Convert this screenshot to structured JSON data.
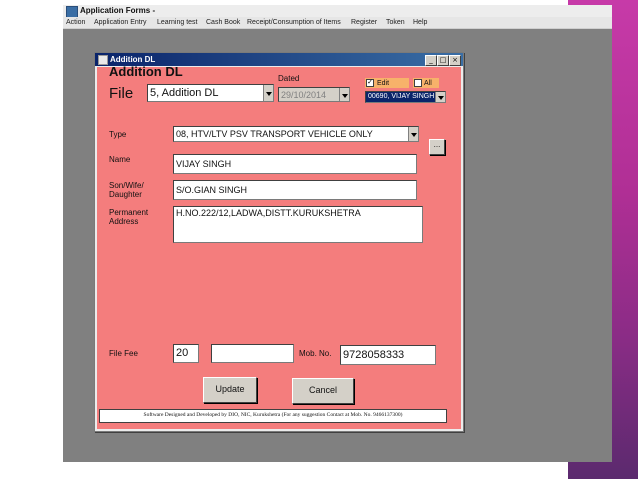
{
  "app": {
    "title": "Application Forms -",
    "menu": [
      "Action",
      "Application Entry",
      "Learning test",
      "Cash Book",
      "Receipt/Consumption of Items",
      "Register",
      "Token",
      "Help"
    ]
  },
  "dialog": {
    "title": "Addition DL",
    "heading": "Addition DL",
    "controls": {
      "minimize": "_",
      "maximize": "□",
      "close": "×"
    },
    "file": {
      "label": "File",
      "value": "5, Addition DL"
    },
    "dated": {
      "label": "Dated",
      "value": "29/10/2014"
    },
    "edit": {
      "label": "Edit",
      "checked": true,
      "mark": "✓"
    },
    "all": {
      "label": "All",
      "checked": false
    },
    "user": {
      "value": "00690, VIJAY SINGH"
    },
    "type": {
      "label": "Type",
      "value": "08, HTV/LTV PSV TRANSPORT VEHICLE ONLY"
    },
    "more_button": "...",
    "name": {
      "label": "Name",
      "value": "VIJAY SINGH"
    },
    "relation": {
      "label_line1": "Son/Wife/",
      "label_line2": "Daughter",
      "value": "S/O.GIAN SINGH"
    },
    "address": {
      "label_line1": "Permanent",
      "label_line2": "Address",
      "value": "H.NO.222/12,LADWA,DISTT.KURUKSHETRA"
    },
    "file_fee": {
      "label": "File Fee",
      "value": "20",
      "extra_value": ""
    },
    "mobile": {
      "label": "Mob. No.",
      "value": "9728058333"
    },
    "update_button": "Update",
    "cancel_button": "Cancel",
    "footer": "Software Designed and Developed by DIO, NIC, Kurukshetra (For any suggestion Contact at Mob. No. 9466137300)"
  },
  "colors": {
    "form_bg": "#f47d7d",
    "titlebar": "#0a246a",
    "mdi_bg": "#808080",
    "right_pane": "#b02f95"
  }
}
